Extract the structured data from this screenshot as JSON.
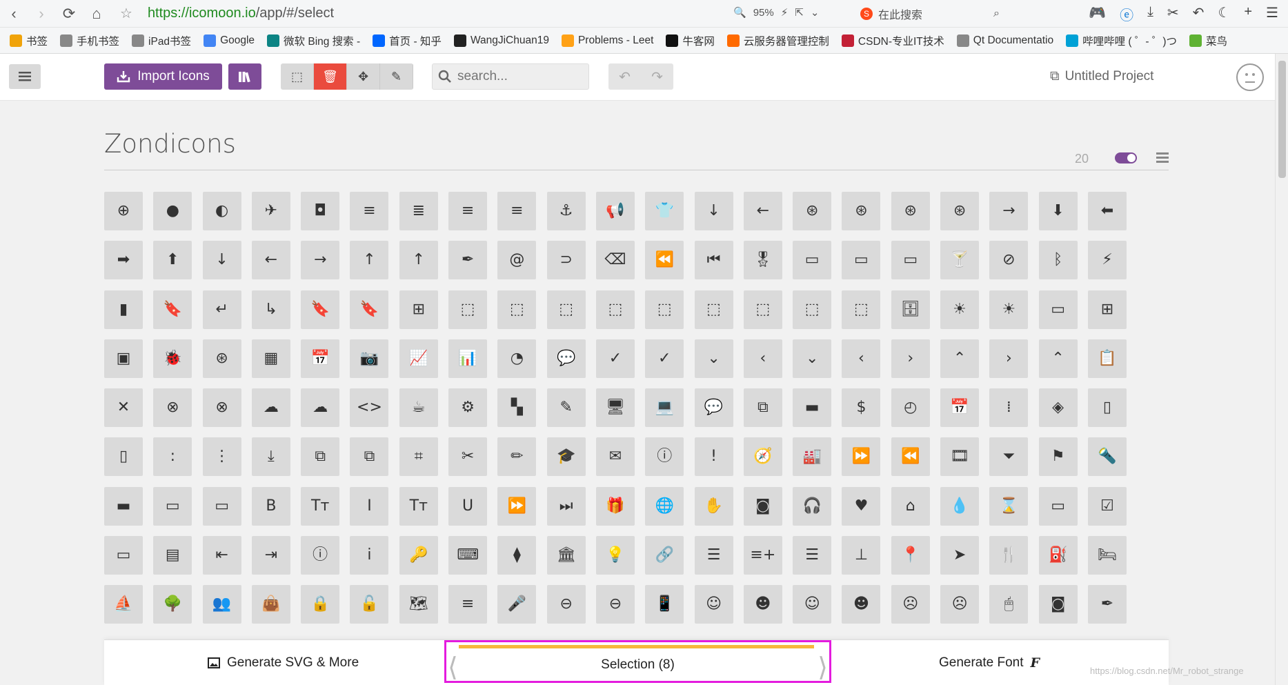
{
  "browser": {
    "url_scheme_host": "https://icomoon.io",
    "url_path": "/app/#/select",
    "zoom": "95%",
    "search_placeholder": "在此搜索",
    "bookmarks": [
      {
        "label": "书签",
        "icon": "star-icon",
        "color": "#f0a30a"
      },
      {
        "label": "手机书签",
        "icon": "phone-icon",
        "color": "#888888"
      },
      {
        "label": "iPad书签",
        "icon": "tablet-icon",
        "color": "#888888"
      },
      {
        "label": "Google",
        "icon": "google-icon",
        "color": "#4285f4"
      },
      {
        "label": "微软 Bing 搜索 - ",
        "icon": "bing-icon",
        "color": "#0c8484"
      },
      {
        "label": "首页 - 知乎",
        "icon": "zhihu-icon",
        "color": "#0066ff"
      },
      {
        "label": "WangJiChuan19",
        "icon": "github-icon",
        "color": "#222222"
      },
      {
        "label": "Problems - Leet",
        "icon": "leetcode-icon",
        "color": "#ffa116"
      },
      {
        "label": "牛客网",
        "icon": "nowcoder-icon",
        "color": "#111111"
      },
      {
        "label": "云服务器管理控制",
        "icon": "aliyun-icon",
        "color": "#ff6a00"
      },
      {
        "label": "CSDN-专业IT技术",
        "icon": "csdn-icon",
        "color": "#c32136"
      },
      {
        "label": "Qt Documentatio",
        "icon": "globe-icon",
        "color": "#888888"
      },
      {
        "label": "哔哩哔哩 ( ゜- ゜)つ",
        "icon": "bilibili-icon",
        "color": "#00a1d6"
      },
      {
        "label": "菜鸟",
        "icon": "runoob-icon",
        "color": "#5fb233"
      }
    ]
  },
  "toolbar": {
    "import_label": "Import Icons",
    "search_placeholder": "search...",
    "project_label": "Untitled Project"
  },
  "iconset": {
    "title": "Zondicons",
    "count": "20"
  },
  "icons": [
    "⊕",
    "●",
    "◐",
    "✈",
    "◘",
    "≡",
    "≣",
    "≡",
    "≡",
    "⚓",
    "📢",
    "👕",
    "↓",
    "←",
    "⊛",
    "⊛",
    "⊛",
    "⊛",
    "→",
    "⬇",
    "⬅",
    "➡",
    "⬆",
    "↓",
    "←",
    "→",
    "↑",
    "↑",
    "✒",
    "@",
    "⊃",
    "⌫",
    "⏪",
    "⏮",
    "🎖",
    "▭",
    "▭",
    "▭",
    "🍸",
    "⊘",
    "ᛒ",
    "⚡",
    "▮",
    "🔖",
    "↵",
    "↳",
    "🔖",
    "🔖",
    "⊞",
    "⬚",
    "⬚",
    "⬚",
    "⬚",
    "⬚",
    "⬚",
    "⬚",
    "⬚",
    "⬚",
    "🗄",
    "☀",
    "☀",
    "▭",
    "⊞",
    "▣",
    "🐞",
    "⊛",
    "▦",
    "📅",
    "📷",
    "📈",
    "📊",
    "◔",
    "💬",
    "✓",
    "✓",
    "⌄",
    "‹",
    "⌄",
    "‹",
    "›",
    "⌃",
    "›",
    "⌃",
    "📋",
    "✕",
    "⊗",
    "⊗",
    "☁",
    "☁",
    "<>",
    "☕",
    "⚙",
    "▚",
    "✎",
    "🖥",
    "💻",
    "💬",
    "⧉",
    "▬",
    "$",
    "◴",
    "📅",
    "⁞",
    "◈",
    "▯",
    "▯",
    ":",
    "⋮",
    "⤓",
    "⧉",
    "⧉",
    "⌗",
    "✂",
    "✏",
    "🎓",
    "✉",
    "ⓘ",
    "!",
    "🧭",
    "🏭",
    "⏩",
    "⏪",
    "🎞",
    "⏷",
    "⚑",
    "🔦",
    "▬",
    "▭",
    "▭",
    "B",
    "Tт",
    "I",
    "Tт",
    "U",
    "⏩",
    "⏭",
    "🎁",
    "🌐",
    "✋",
    "◙",
    "🎧",
    "♥",
    "⌂",
    "💧",
    "⌛",
    "▭",
    "☑",
    "▭",
    "▤",
    "⇤",
    "⇥",
    "ⓘ",
    "i",
    "🔑",
    "⌨",
    "⧫",
    "🏛",
    "💡",
    "🔗",
    "☰",
    "≡+",
    "☰",
    "⊥",
    "📍",
    "➤",
    "🍴",
    "⛽",
    "🛏",
    "⛵",
    "🌳",
    "👥",
    "👜",
    "🔒",
    "🔓",
    "🗺",
    "≡",
    "🎤",
    "⊖",
    "⊖",
    "📱",
    "☺",
    "☻",
    "☺",
    "☻",
    "☹",
    "☹",
    "🖱",
    "◙",
    "✒"
  ],
  "bottom_bar": {
    "generate_svg_label": "Generate SVG & More",
    "selection_label": "Selection (8)",
    "generate_font_label": "Generate Font",
    "font_glyph": "F"
  },
  "watermark": "https://blog.csdn.net/Mr_robot_strange"
}
